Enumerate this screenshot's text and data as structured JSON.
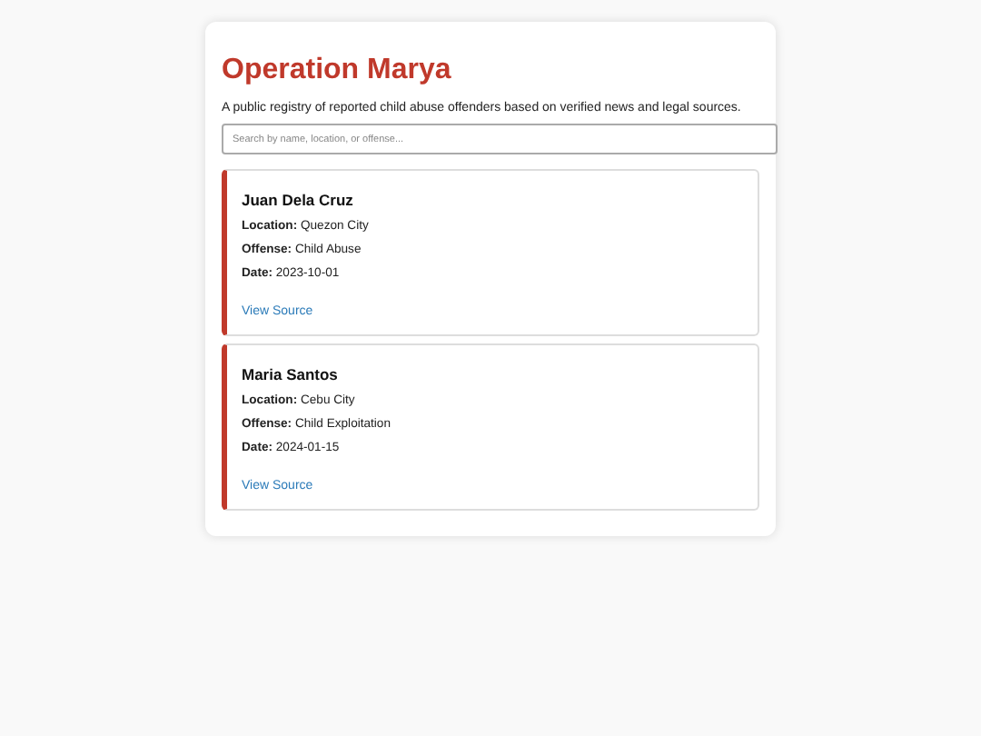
{
  "header": {
    "title": "Operation Marya",
    "subtitle": "A public registry of reported child abuse offenders based on verified news and legal sources."
  },
  "search": {
    "placeholder": "Search by name, location, or offense..."
  },
  "entries": [
    {
      "name": "Juan Dela Cruz",
      "details": [
        "**Location:** Quezon City",
        "**Offense:** Child Abuse",
        "**Date:** 2023-10-01"
      ],
      "link": "View Source"
    },
    {
      "name": "Maria Santos",
      "details": [
        "**Location:** Cebu City",
        "**Offense:** Child Exploitation",
        "**Date:** 2024-01-15"
      ],
      "link": "View Source"
    }
  ]
}
